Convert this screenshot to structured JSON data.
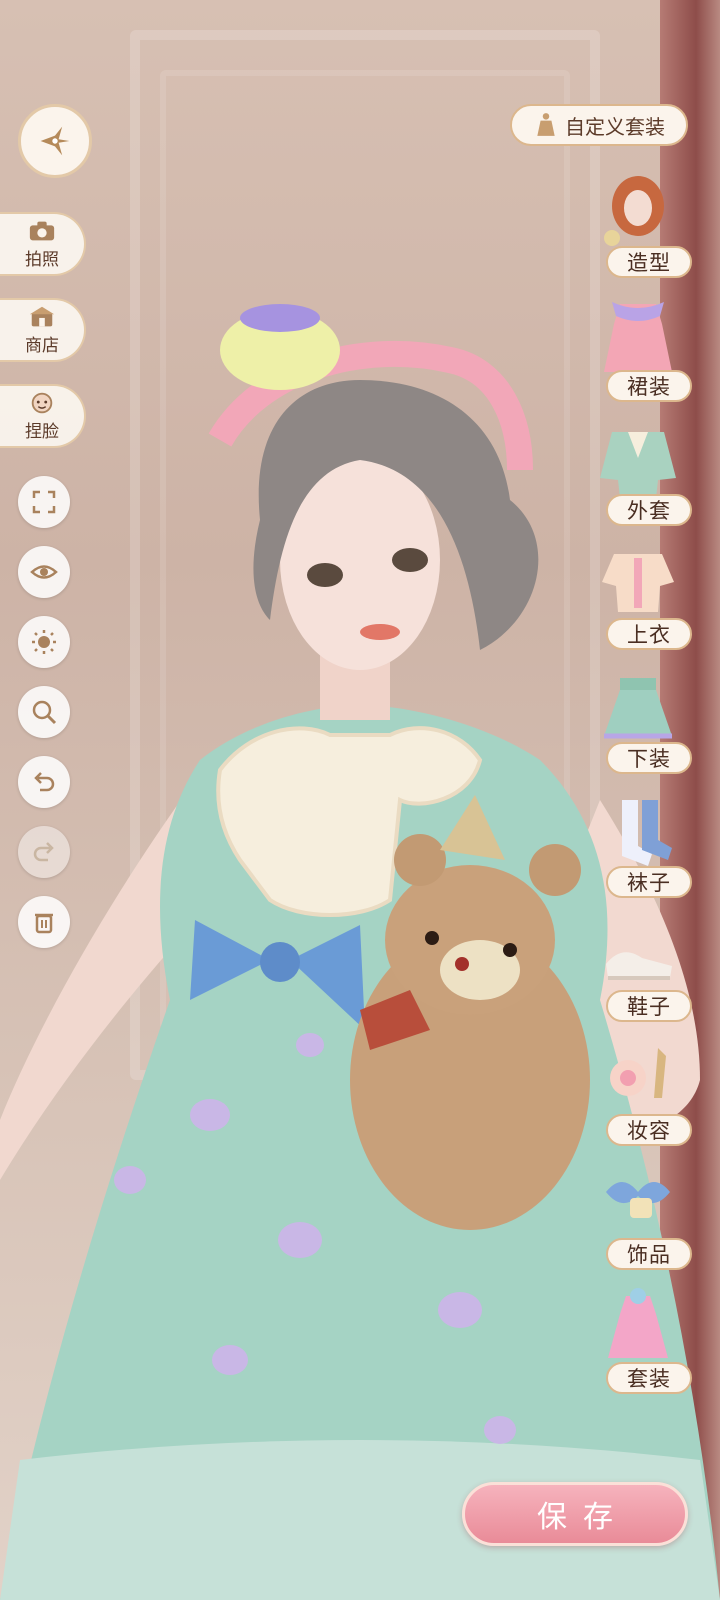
{
  "left_toolbar": {
    "back": {
      "icon": "compass-star-icon"
    },
    "photo": {
      "label": "拍照",
      "icon": "camera-icon"
    },
    "shop": {
      "label": "商店",
      "icon": "shop-icon"
    },
    "face": {
      "label": "捏脸",
      "icon": "face-icon"
    },
    "tools": [
      {
        "name": "fullscreen-icon",
        "enabled": true
      },
      {
        "name": "eye-icon",
        "enabled": true
      },
      {
        "name": "brightness-icon",
        "enabled": true
      },
      {
        "name": "zoom-icon",
        "enabled": true
      },
      {
        "name": "undo-icon",
        "enabled": true
      },
      {
        "name": "redo-icon",
        "enabled": false
      },
      {
        "name": "trash-icon",
        "enabled": true
      }
    ]
  },
  "right_panel": {
    "custom_outfit_label": "自定义套装",
    "categories": [
      {
        "label": "造型",
        "icon": "hairstyle-icon"
      },
      {
        "label": "裙装",
        "icon": "dress-icon"
      },
      {
        "label": "外套",
        "icon": "coat-icon"
      },
      {
        "label": "上衣",
        "icon": "top-icon"
      },
      {
        "label": "下装",
        "icon": "skirt-icon"
      },
      {
        "label": "袜子",
        "icon": "socks-icon"
      },
      {
        "label": "鞋子",
        "icon": "shoes-icon"
      },
      {
        "label": "妆容",
        "icon": "makeup-icon"
      },
      {
        "label": "饰品",
        "icon": "accessory-icon"
      },
      {
        "label": "套装",
        "icon": "outfit-set-icon"
      }
    ]
  },
  "save_label": "保存",
  "colors": {
    "accent_pink": "#e98b98",
    "pill_bg": "#fbf4ec",
    "pill_border": "#dcb78d",
    "text_brown": "#4a2e22",
    "dress_mint": "#9fcfc0"
  }
}
